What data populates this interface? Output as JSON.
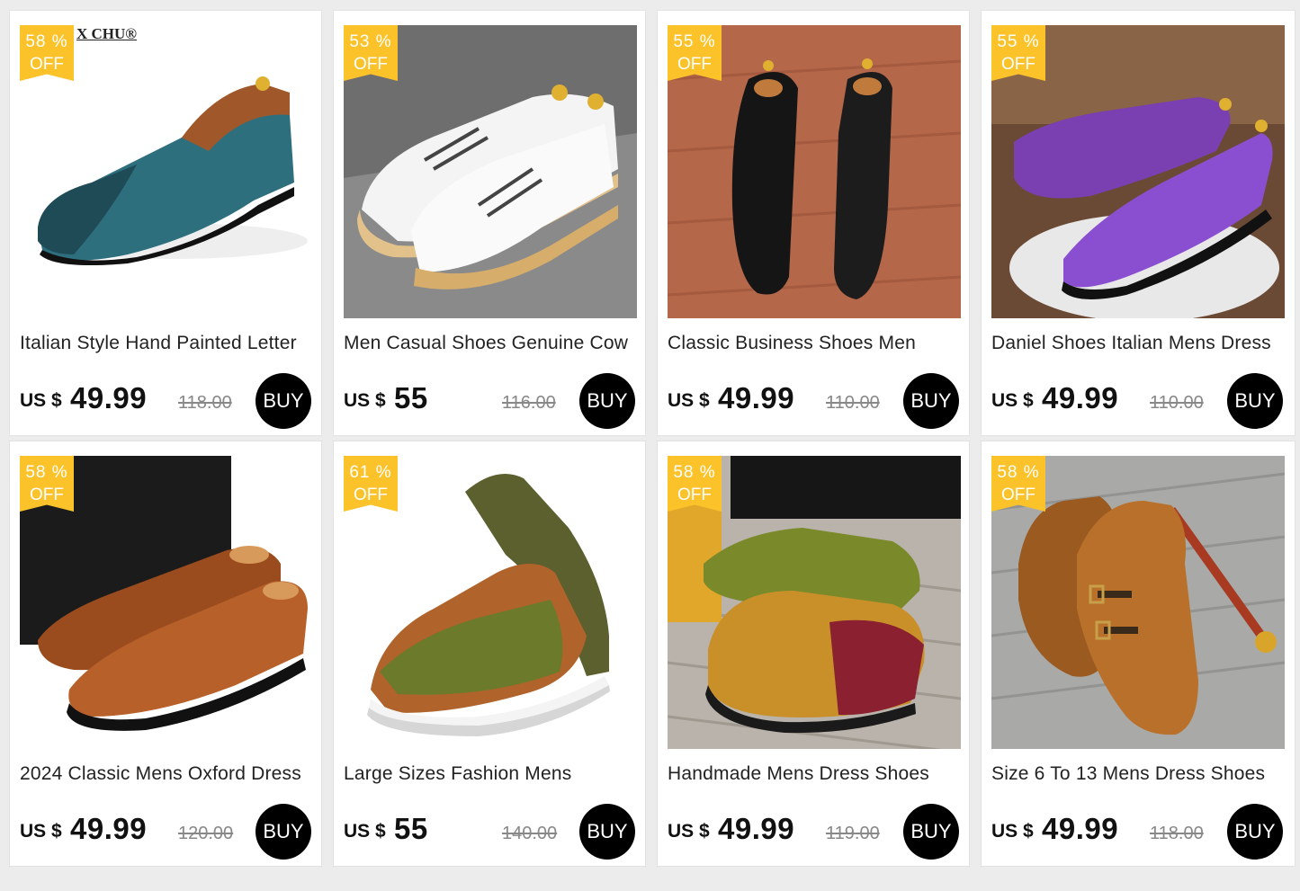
{
  "products": [
    {
      "discount_pct": "58 %",
      "off_label": "OFF",
      "title": "Italian Style Hand Painted Letter",
      "currency": "US $",
      "price": "49.99",
      "old_price": "118.00",
      "buy_label": "BUY",
      "brand_mark": "X CHU®",
      "image_icon": "teal-loafer-image"
    },
    {
      "discount_pct": "53 %",
      "off_label": "OFF",
      "title": "Men Casual Shoes Genuine Cow",
      "currency": "US $",
      "price": "55",
      "old_price": "116.00",
      "buy_label": "BUY",
      "image_icon": "white-sneaker-image"
    },
    {
      "discount_pct": "55 %",
      "off_label": "OFF",
      "title": "Classic Business Shoes Men",
      "currency": "US $",
      "price": "49.99",
      "old_price": "110.00",
      "buy_label": "BUY",
      "image_icon": "black-oxford-image"
    },
    {
      "discount_pct": "55 %",
      "off_label": "OFF",
      "title": "Daniel Shoes Italian Mens Dress",
      "currency": "US $",
      "price": "49.99",
      "old_price": "110.00",
      "buy_label": "BUY",
      "image_icon": "purple-oxford-image"
    },
    {
      "discount_pct": "58 %",
      "off_label": "OFF",
      "title": "2024 Classic Mens Oxford Dress",
      "currency": "US $",
      "price": "49.99",
      "old_price": "120.00",
      "buy_label": "BUY",
      "image_icon": "brown-brogue-image"
    },
    {
      "discount_pct": "61 %",
      "off_label": "OFF",
      "title": "Large Sizes Fashion Mens",
      "currency": "US $",
      "price": "55",
      "old_price": "140.00",
      "buy_label": "BUY",
      "image_icon": "green-brown-sneaker-image"
    },
    {
      "discount_pct": "58 %",
      "off_label": "OFF",
      "title": "Handmade Mens Dress Shoes",
      "currency": "US $",
      "price": "49.99",
      "old_price": "119.00",
      "buy_label": "BUY",
      "image_icon": "patina-oxford-image"
    },
    {
      "discount_pct": "58 %",
      "off_label": "OFF",
      "title": "Size 6 To 13 Mens Dress Shoes",
      "currency": "US $",
      "price": "49.99",
      "old_price": "118.00",
      "buy_label": "BUY",
      "image_icon": "monk-strap-image"
    }
  ],
  "colors": {
    "badge": "#fbc22a",
    "buy_button": "#000000",
    "page_background": "#ececec"
  }
}
